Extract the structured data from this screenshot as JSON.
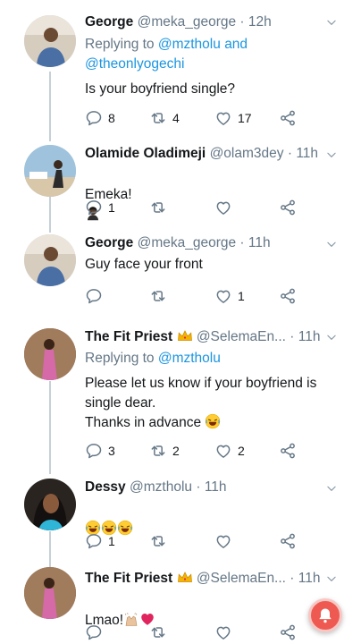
{
  "tweets": [
    {
      "name": "George",
      "handle": "@meka_george",
      "time": "12h",
      "replying_prefix": "Replying to",
      "reply_m1": "@mztholu",
      "reply_and": "and",
      "reply_m2": "@theonlyogechi",
      "text": "Is your boyfriend single?",
      "replies": "8",
      "retweets": "4",
      "likes": "17"
    },
    {
      "name": "Olamide Oladimeji",
      "handle": "@olam3dey",
      "time": "11h",
      "text": "Emeka!",
      "replies": "1",
      "retweets": "",
      "likes": ""
    },
    {
      "name": "George",
      "handle": "@meka_george",
      "time": "11h",
      "text": "Guy face your front",
      "replies": "",
      "retweets": "",
      "likes": "1"
    },
    {
      "name": "The Fit Priest",
      "handle": "@SelemaEn...",
      "time": "11h",
      "replying_prefix": "Replying to",
      "reply_m1": "@mztholu",
      "text": "Please let us know if your boyfriend is single dear.\nThanks in advance",
      "replies": "3",
      "retweets": "2",
      "likes": "2"
    },
    {
      "name": "Dessy",
      "handle": "@mztholu",
      "time": "11h",
      "text": "",
      "replies": "1",
      "retweets": "",
      "likes": ""
    },
    {
      "name": "The Fit Priest",
      "handle": "@SelemaEn...",
      "time": "11h",
      "text": "Lmao!",
      "replies": "",
      "retweets": "",
      "likes": ""
    }
  ],
  "icons": {
    "reply": "reply-icon",
    "retweet": "retweet-icon",
    "like": "heart-icon",
    "share": "share-icon",
    "caret": "chevron-down-icon",
    "fab": "notification-bell-icon"
  },
  "colors": {
    "link": "#1b95e0",
    "secondary": "#657786",
    "fab": "#ee5a52"
  }
}
